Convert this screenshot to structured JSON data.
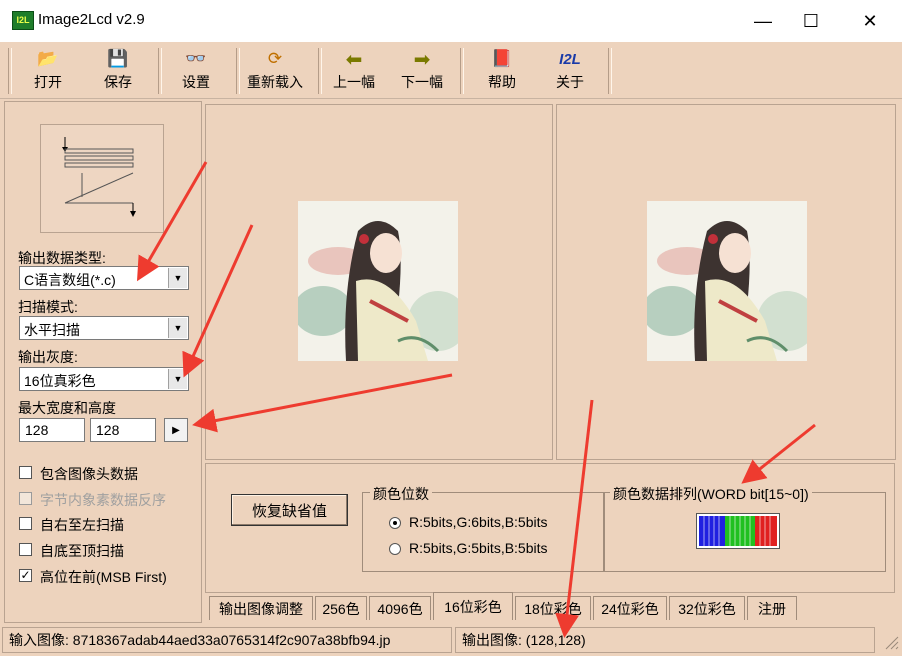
{
  "window": {
    "title": "Image2Lcd v2.9",
    "icon_text": "I2L"
  },
  "toolbar": {
    "open": "打开",
    "save": "保存",
    "settings": "设置",
    "reload": "重新载入",
    "prev": "上一幅",
    "next": "下一幅",
    "help": "帮助",
    "about": "关于",
    "about_icon": "I2L"
  },
  "left": {
    "output_type_label": "输出数据类型:",
    "output_type_value": "C语言数组(*.c)",
    "scan_mode_label": "扫描模式:",
    "scan_mode_value": "水平扫描",
    "gray_label": "输出灰度:",
    "gray_value": "16位真彩色",
    "max_size_label": "最大宽度和高度",
    "max_width": "128",
    "max_height": "128",
    "checkboxes": [
      {
        "label": "包含图像头数据",
        "checked": false,
        "enabled": true
      },
      {
        "label": "字节内象素数据反序",
        "checked": false,
        "enabled": false
      },
      {
        "label": "自右至左扫描",
        "checked": false,
        "enabled": true
      },
      {
        "label": "自底至顶扫描",
        "checked": false,
        "enabled": true
      },
      {
        "label": "高位在前(MSB First)",
        "checked": true,
        "enabled": true
      }
    ]
  },
  "bottom": {
    "restore_default": "恢复缺省值",
    "color_bits_title": "颜色位数",
    "radio_565": "R:5bits,G:6bits,B:5bits",
    "radio_555": "R:5bits,G:5bits,B:5bits",
    "color_order_title": "颜色数据排列(WORD bit[15~0])",
    "tabs": [
      "输出图像调整",
      "256色",
      "4096色",
      "16位彩色",
      "18位彩色",
      "24位彩色",
      "32位彩色",
      "注册"
    ],
    "active_tab": 3
  },
  "status": {
    "input": "输入图像: 8718367adab44aed33a0765314f2c907a38bfb94.jp",
    "output": "输出图像: (128,128)"
  },
  "colors": {
    "bg": "#edd3bd",
    "arrow": "#ee3b2f"
  }
}
